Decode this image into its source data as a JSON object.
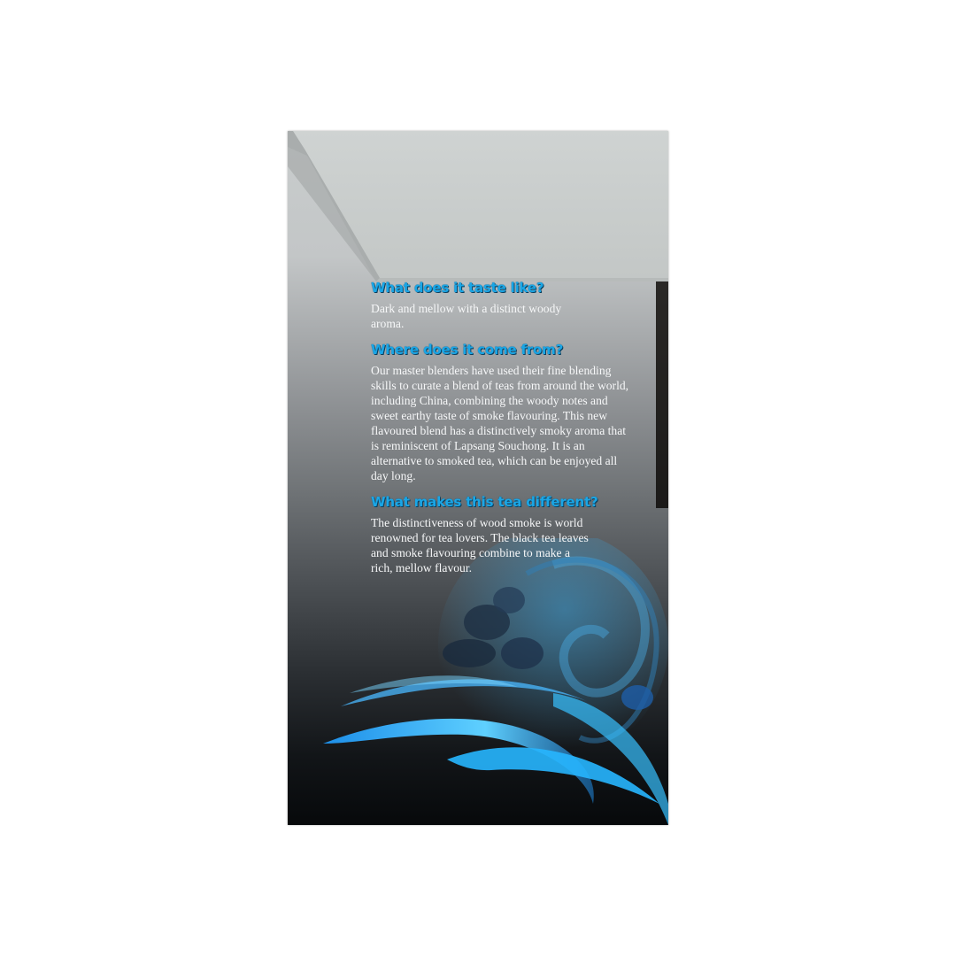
{
  "sections": [
    {
      "heading": "What does it taste like?",
      "body": "Dark and mellow with a distinct woody aroma."
    },
    {
      "heading": "Where does it come from?",
      "body": "Our master blenders have used their fine blending skills to curate a blend of teas from around the world, including China, combining the woody notes and sweet earthy taste of smoke flavouring. This new flavoured blend has a distinctively smoky aroma that is reminiscent of Lapsang Souchong. It is an alternative to smoked tea, which can be enjoyed all day long."
    },
    {
      "heading": "What makes this tea different?",
      "body": "The distinctiveness of wood smoke is world renowned for tea lovers. The black tea leaves and smoke flavouring combine to make a rich, mellow flavour."
    }
  ],
  "colors": {
    "heading": "#1aa6e6",
    "body_text": "#f6f7f8",
    "lid": "#c8cccb",
    "swirl_accent": "#27b6ff"
  }
}
